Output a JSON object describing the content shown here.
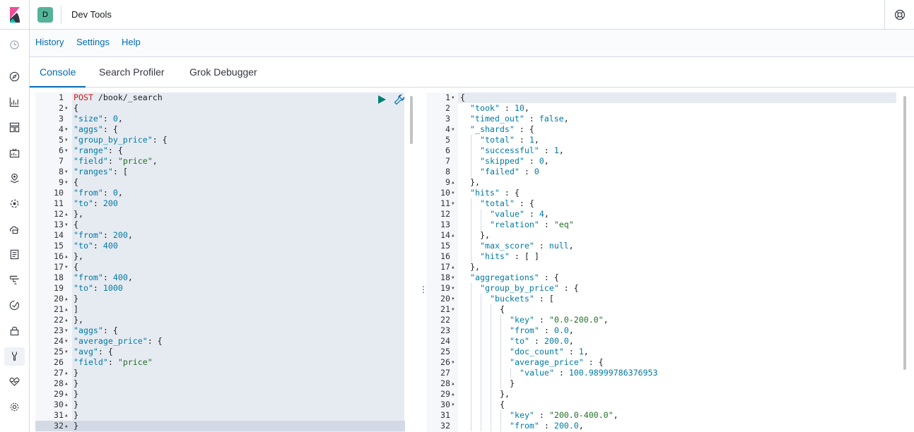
{
  "header": {
    "space_initial": "D",
    "app_title": "Dev Tools"
  },
  "nav": {
    "icons": [
      "clock-icon",
      "compass-icon",
      "visualize-icon",
      "dashboard-icon",
      "canvas-icon",
      "maps-icon",
      "ml-icon",
      "infra-icon",
      "logs-icon",
      "apm-icon",
      "uptime-icon",
      "lock-icon",
      "devtools-icon",
      "monitoring-icon",
      "gear-icon"
    ]
  },
  "menu": {
    "history": "History",
    "settings": "Settings",
    "help": "Help"
  },
  "tabs": {
    "console": "Console",
    "search_profiler": "Search Profiler",
    "grok_debugger": "Grok Debugger"
  },
  "request": {
    "lines": [
      {
        "n": "1",
        "f": "",
        "t": "POST /book/_search"
      },
      {
        "n": "2",
        "f": "v",
        "t": "{"
      },
      {
        "n": "3",
        "f": "",
        "t": "\"size\": 0,"
      },
      {
        "n": "4",
        "f": "v",
        "t": "\"aggs\": {"
      },
      {
        "n": "5",
        "f": "v",
        "t": "\"group_by_price\": {"
      },
      {
        "n": "6",
        "f": "v",
        "t": "\"range\": {"
      },
      {
        "n": "7",
        "f": "",
        "t": "\"field\": \"price\","
      },
      {
        "n": "8",
        "f": "v",
        "t": "\"ranges\": ["
      },
      {
        "n": "9",
        "f": "v",
        "t": "{"
      },
      {
        "n": "10",
        "f": "",
        "t": "\"from\": 0,"
      },
      {
        "n": "11",
        "f": "",
        "t": "\"to\": 200"
      },
      {
        "n": "12",
        "f": "^",
        "t": "},"
      },
      {
        "n": "13",
        "f": "v",
        "t": "{"
      },
      {
        "n": "14",
        "f": "",
        "t": "\"from\": 200,"
      },
      {
        "n": "15",
        "f": "",
        "t": "\"to\": 400"
      },
      {
        "n": "16",
        "f": "^",
        "t": "},"
      },
      {
        "n": "17",
        "f": "v",
        "t": "{"
      },
      {
        "n": "18",
        "f": "",
        "t": "\"from\": 400,"
      },
      {
        "n": "19",
        "f": "",
        "t": "\"to\": 1000"
      },
      {
        "n": "20",
        "f": "^",
        "t": "}"
      },
      {
        "n": "21",
        "f": "^",
        "t": "]"
      },
      {
        "n": "22",
        "f": "^",
        "t": "},"
      },
      {
        "n": "23",
        "f": "v",
        "t": "\"aggs\": {"
      },
      {
        "n": "24",
        "f": "v",
        "t": "\"average_price\": {"
      },
      {
        "n": "25",
        "f": "v",
        "t": "\"avg\": {"
      },
      {
        "n": "26",
        "f": "",
        "t": "\"field\": \"price\""
      },
      {
        "n": "27",
        "f": "^",
        "t": "}"
      },
      {
        "n": "28",
        "f": "^",
        "t": "}"
      },
      {
        "n": "29",
        "f": "^",
        "t": "}"
      },
      {
        "n": "30",
        "f": "^",
        "t": "}"
      },
      {
        "n": "31",
        "f": "^",
        "t": "}"
      },
      {
        "n": "32",
        "f": "^",
        "t": "}"
      }
    ]
  },
  "response": {
    "lines": [
      {
        "n": "1",
        "f": "v",
        "i": 0,
        "t": "{"
      },
      {
        "n": "2",
        "f": "",
        "i": 1,
        "t": "\"took\" : 10,"
      },
      {
        "n": "3",
        "f": "",
        "i": 1,
        "t": "\"timed_out\" : false,"
      },
      {
        "n": "4",
        "f": "v",
        "i": 1,
        "t": "\"_shards\" : {"
      },
      {
        "n": "5",
        "f": "",
        "i": 2,
        "t": "\"total\" : 1,"
      },
      {
        "n": "6",
        "f": "",
        "i": 2,
        "t": "\"successful\" : 1,"
      },
      {
        "n": "7",
        "f": "",
        "i": 2,
        "t": "\"skipped\" : 0,"
      },
      {
        "n": "8",
        "f": "",
        "i": 2,
        "t": "\"failed\" : 0"
      },
      {
        "n": "9",
        "f": "^",
        "i": 1,
        "t": "},"
      },
      {
        "n": "10",
        "f": "v",
        "i": 1,
        "t": "\"hits\" : {"
      },
      {
        "n": "11",
        "f": "v",
        "i": 2,
        "t": "\"total\" : {"
      },
      {
        "n": "12",
        "f": "",
        "i": 3,
        "t": "\"value\" : 4,"
      },
      {
        "n": "13",
        "f": "",
        "i": 3,
        "t": "\"relation\" : \"eq\""
      },
      {
        "n": "14",
        "f": "^",
        "i": 2,
        "t": "},"
      },
      {
        "n": "15",
        "f": "",
        "i": 2,
        "t": "\"max_score\" : null,"
      },
      {
        "n": "16",
        "f": "",
        "i": 2,
        "t": "\"hits\" : [ ]"
      },
      {
        "n": "17",
        "f": "^",
        "i": 1,
        "t": "},"
      },
      {
        "n": "18",
        "f": "v",
        "i": 1,
        "t": "\"aggregations\" : {"
      },
      {
        "n": "19",
        "f": "v",
        "i": 2,
        "t": "\"group_by_price\" : {"
      },
      {
        "n": "20",
        "f": "v",
        "i": 3,
        "t": "\"buckets\" : ["
      },
      {
        "n": "21",
        "f": "v",
        "i": 4,
        "t": "{"
      },
      {
        "n": "22",
        "f": "",
        "i": 5,
        "t": "\"key\" : \"0.0-200.0\","
      },
      {
        "n": "23",
        "f": "",
        "i": 5,
        "t": "\"from\" : 0.0,"
      },
      {
        "n": "24",
        "f": "",
        "i": 5,
        "t": "\"to\" : 200.0,"
      },
      {
        "n": "25",
        "f": "",
        "i": 5,
        "t": "\"doc_count\" : 1,"
      },
      {
        "n": "26",
        "f": "v",
        "i": 5,
        "t": "\"average_price\" : {"
      },
      {
        "n": "27",
        "f": "",
        "i": 6,
        "t": "\"value\" : 100.98999786376953"
      },
      {
        "n": "28",
        "f": "^",
        "i": 5,
        "t": "}"
      },
      {
        "n": "29",
        "f": "^",
        "i": 4,
        "t": "},"
      },
      {
        "n": "30",
        "f": "v",
        "i": 4,
        "t": "{"
      },
      {
        "n": "31",
        "f": "",
        "i": 5,
        "t": "\"key\" : \"200.0-400.0\","
      },
      {
        "n": "32",
        "f": "",
        "i": 5,
        "t": "\"from\" : 200.0,"
      }
    ]
  },
  "colors": {
    "accent": "#006bb4",
    "space_badge": "#54b399",
    "run_button": "#017d73"
  }
}
